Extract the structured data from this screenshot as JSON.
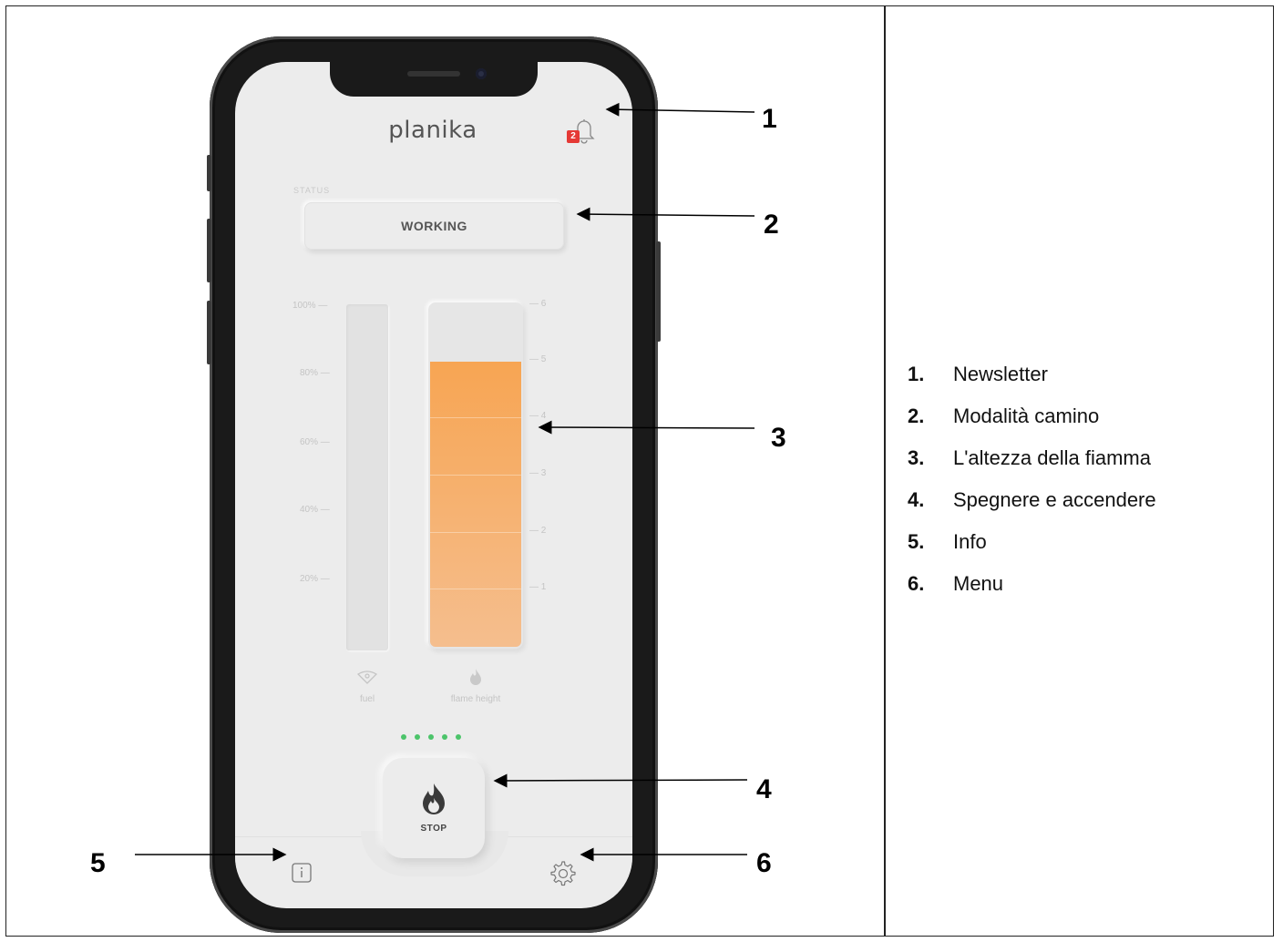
{
  "app": {
    "logo": "planika",
    "notification_count": "2",
    "status_label": "STATUS",
    "status_value": "WORKING"
  },
  "fuel_gauge": {
    "ticks": [
      "100%",
      "80%",
      "60%",
      "40%",
      "20%"
    ],
    "label": "fuel",
    "level": 0
  },
  "flame_gauge": {
    "ticks": [
      "6",
      "5",
      "4",
      "3",
      "2",
      "1"
    ],
    "label": "flame height",
    "level": 5,
    "max": 6
  },
  "indicator_dots": 5,
  "stop_button": {
    "label": "STOP",
    "icon": "flame-icon"
  },
  "bottom_nav": {
    "info_icon": "info-icon",
    "settings_icon": "gear-icon"
  },
  "callouts": [
    "1",
    "2",
    "3",
    "4",
    "5",
    "6"
  ],
  "legend": [
    {
      "num": "1.",
      "text": "Newsletter"
    },
    {
      "num": "2.",
      "text": "Modalità camino"
    },
    {
      "num": "3.",
      "text": "L'altezza della fiamma"
    },
    {
      "num": "4.",
      "text": "Spegnere e accendere"
    },
    {
      "num": "5.",
      "text": "Info"
    },
    {
      "num": "6.",
      "text": "Menu"
    }
  ],
  "colors": {
    "flame_top": "#f7a553",
    "flame_bottom": "#f5be8e",
    "dot_green": "#4cc46a",
    "badge_red": "#e53935"
  }
}
